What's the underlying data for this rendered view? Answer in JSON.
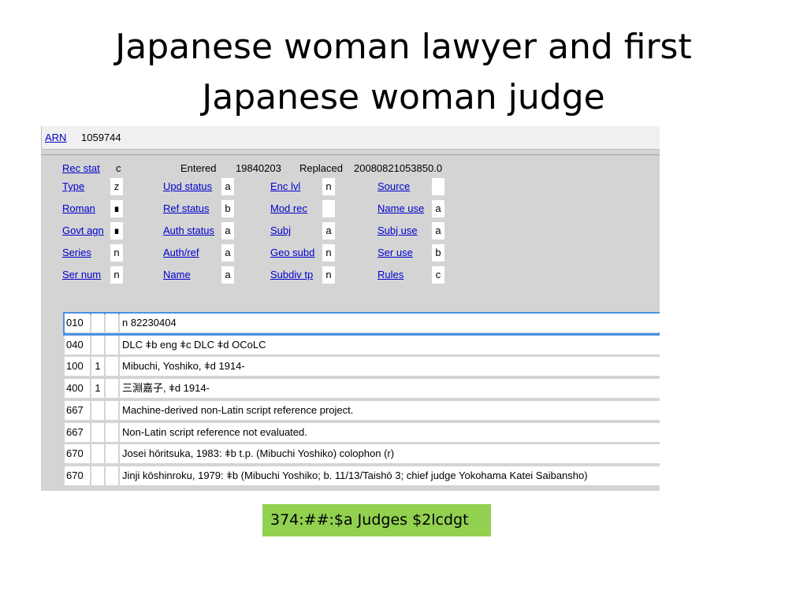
{
  "slide": {
    "title_line1": "Japanese woman lawyer and first",
    "title_line2": "Japanese woman judge",
    "badge": "374:##:$a Judges $2lcdgt"
  },
  "record": {
    "arn_label": "ARN",
    "arn_value": "1059744",
    "header": {
      "rec_stat_label": "Rec stat",
      "rec_stat_value": "c",
      "entered_label": "Entered",
      "entered_value": "19840203",
      "replaced_label": "Replaced",
      "replaced_value": "20080821053850.0"
    },
    "fixed_fields": [
      [
        {
          "label": "Type",
          "value": "z"
        },
        {
          "label": "Upd status",
          "value": "a"
        },
        {
          "label": "Enc lvl",
          "value": "n"
        },
        {
          "label": "Source",
          "value": ""
        }
      ],
      [
        {
          "label": "Roman",
          "value": "∎"
        },
        {
          "label": "Ref status",
          "value": "b"
        },
        {
          "label": "Mod rec",
          "value": ""
        },
        {
          "label": "Name use",
          "value": "a"
        }
      ],
      [
        {
          "label": "Govt agn",
          "value": "∎"
        },
        {
          "label": "Auth status",
          "value": "a"
        },
        {
          "label": "Subj",
          "value": "a"
        },
        {
          "label": "Subj use",
          "value": "a"
        }
      ],
      [
        {
          "label": "Series",
          "value": "n"
        },
        {
          "label": "Auth/ref",
          "value": "a"
        },
        {
          "label": "Geo subd",
          "value": "n"
        },
        {
          "label": "Ser use",
          "value": "b"
        }
      ],
      [
        {
          "label": "Ser num",
          "value": "n"
        },
        {
          "label": "Name",
          "value": "a"
        },
        {
          "label": "Subdiv tp",
          "value": "n"
        },
        {
          "label": "Rules",
          "value": "c"
        }
      ]
    ],
    "variable_fields": [
      {
        "tag": "010",
        "ind1": "",
        "ind2": "",
        "data": "n  82230404"
      },
      {
        "tag": "040",
        "ind1": "",
        "ind2": "",
        "data": "DLC ǂb eng ǂc DLC ǂd OCoLC"
      },
      {
        "tag": "100",
        "ind1": "1",
        "ind2": "",
        "data": "Mibuchi, Yoshiko, ǂd 1914-"
      },
      {
        "tag": "400",
        "ind1": "1",
        "ind2": "",
        "data": "三淵嘉子, ǂd 1914-"
      },
      {
        "tag": "667",
        "ind1": "",
        "ind2": "",
        "data": "Machine-derived non-Latin script reference project."
      },
      {
        "tag": "667",
        "ind1": "",
        "ind2": "",
        "data": "Non-Latin script reference not evaluated."
      },
      {
        "tag": "670",
        "ind1": "",
        "ind2": "",
        "data": "Josei hōritsuka, 1983: ǂb t.p. (Mibuchi Yoshiko) colophon (r)"
      },
      {
        "tag": "670",
        "ind1": "",
        "ind2": "",
        "data": "Jinji kōshinroku, 1979: ǂb (Mibuchi Yoshiko; b. 11/13/Taishō 3; chief judge Yokohama Katei Saibansho)"
      }
    ]
  }
}
